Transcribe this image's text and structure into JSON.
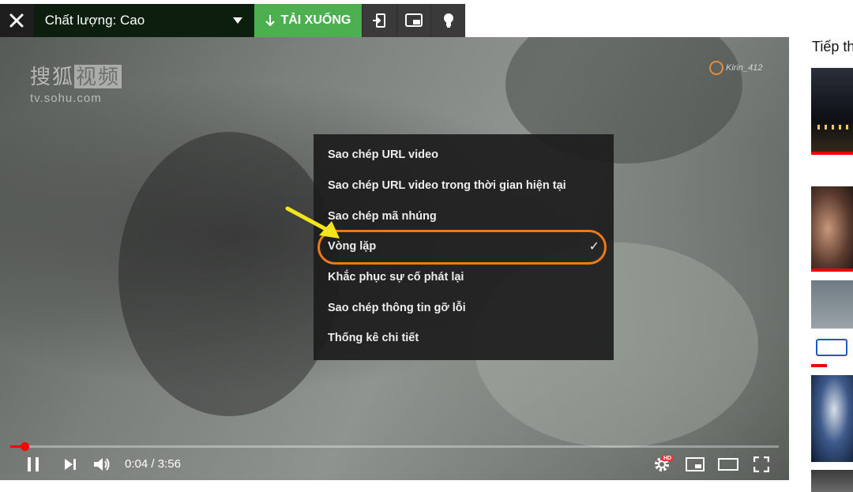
{
  "toolbar": {
    "close_icon": "close-icon",
    "quality_label": "Chất lượng: Cao",
    "download_label": "TẢI XUỐNG",
    "icons": [
      "exit-to-app-icon",
      "picture-in-picture-icon",
      "lightbulb-icon"
    ]
  },
  "video": {
    "watermark_cn_a": "搜狐",
    "watermark_cn_b": "视频",
    "watermark_url": "tv.sohu.com",
    "watermark_channel": "Kirin_412"
  },
  "context_menu": {
    "items": [
      {
        "label": "Sao chép URL video",
        "checked": false
      },
      {
        "label": "Sao chép URL video trong thời gian hiện tại",
        "checked": false
      },
      {
        "label": "Sao chép mã nhúng",
        "checked": false
      },
      {
        "label": "Vòng lặp",
        "checked": true,
        "check_glyph": "✓"
      },
      {
        "label": "Khắc phục sự cố phát lại",
        "checked": false
      },
      {
        "label": "Sao chép thông tin gỡ lỗi",
        "checked": false
      },
      {
        "label": "Thống kê chi tiết",
        "checked": false
      }
    ],
    "highlight_color": "#f07a12",
    "arrow_color": "#f5e61b"
  },
  "player": {
    "current_time": "0:04",
    "separator": " / ",
    "duration": "3:56",
    "progress_fraction": 0.018,
    "hd_badge": "HD",
    "accent_color": "#ff0000"
  },
  "sidebar": {
    "title": "Tiếp th"
  }
}
